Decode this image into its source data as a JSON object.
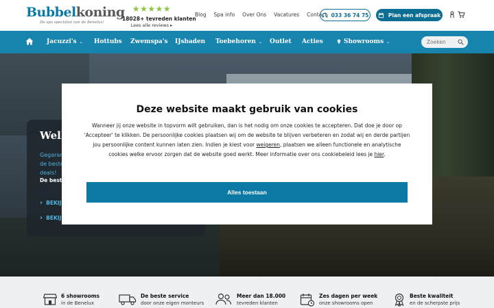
{
  "header": {
    "logo": {
      "part1": "Bubbel",
      "part2": "koning",
      "tagline": "De spa specialist van de Benelux!"
    },
    "reviews": {
      "stars": "★★★★★",
      "count": "18028+ tevreden klanten",
      "link": "Lees alle reviews ▸"
    },
    "top_links": [
      "Blog",
      "Spa info",
      "Over Ons",
      "Vacatures",
      "Contact"
    ],
    "phone": "033 36 74 75",
    "appointment": "Plan een afspraak",
    "accent": "#0d6e94"
  },
  "nav": {
    "items": [
      {
        "label": "Jacuzzi's",
        "dropdown": true
      },
      {
        "label": "Hottubs",
        "dropdown": false
      },
      {
        "label": "Zwemspa's",
        "dropdown": false
      },
      {
        "label": "IJsbaden",
        "dropdown": false
      },
      {
        "label": "Toebehoren",
        "dropdown": true
      },
      {
        "label": "Outlet",
        "dropdown": false
      },
      {
        "label": "Acties",
        "dropdown": false
      },
      {
        "label": "Showrooms",
        "dropdown": true
      }
    ],
    "search_placeholder": "Zoeken",
    "bg": "#1784ad"
  },
  "hero": {
    "title": "Well",
    "subtitle": "Gegarandeerd de beste deals!",
    "text_bold": "De best",
    "links": [
      "BEKIJ",
      "BEKIJ"
    ]
  },
  "cookie_modal": {
    "title": "Deze website maakt gebruik van cookies",
    "body_1": "Wanneer jij onze website in topvorm wilt gebruiken, dan is het nodig om onze cookies te accepteren. Dat doe je door op 'Accepteer' te klikken. De persoonlijke cookies plaatsen wij om de website te blijven verbeteren en zodat wij en derde partijen jou persoonlijke content kunnen laten zien. Indien je kiest voor ",
    "link_1": "weigeren",
    "body_2": ", plaatsen we alleen functionele en analytische cookies welke ervoor zorgen dat de website goed werkt. Meer informatie over ons cookiebeleid lees je ",
    "link_2": "hier",
    "body_3": ".",
    "accept": "Alles toestaan"
  },
  "usps": [
    {
      "icon": "store-icon",
      "line1": "6 showrooms",
      "line2": "in de Benelux"
    },
    {
      "icon": "truck-icon",
      "line1": "De beste service",
      "line2": "door onze eigen monteurs"
    },
    {
      "icon": "people-icon",
      "line1": "Meer dan 18.000",
      "line2": "tevreden klanten"
    },
    {
      "icon": "calendar-icon",
      "line1": "Zes dagen per week",
      "line2": "onze showrooms open"
    },
    {
      "icon": "award-icon",
      "line1": "Beste kwaliteit",
      "line2": "en de scherpste prijs"
    }
  ]
}
